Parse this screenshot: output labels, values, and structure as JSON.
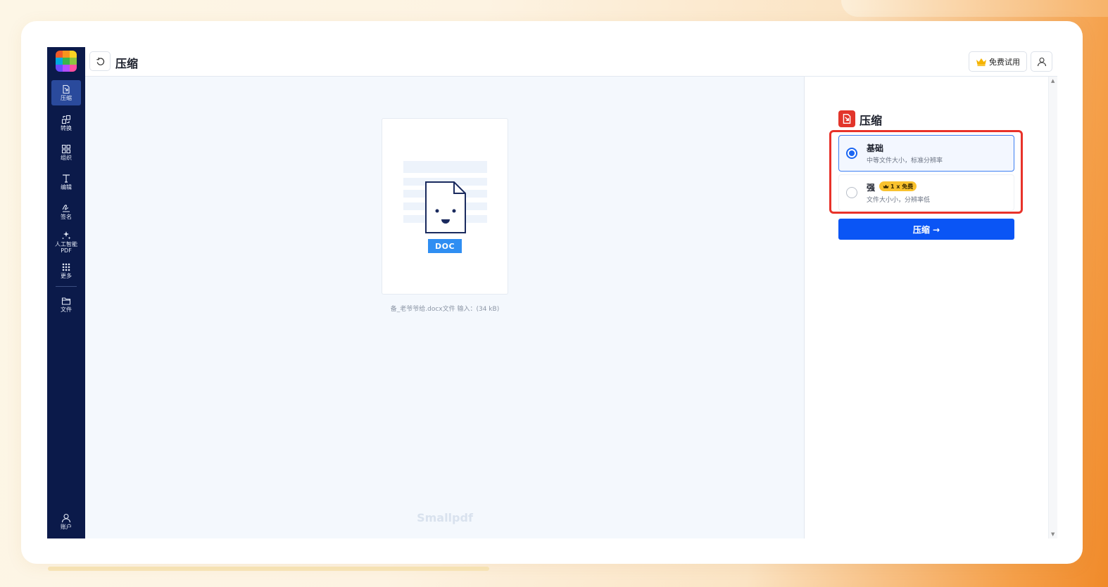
{
  "header": {
    "title": "压缩",
    "back_icon": "undo-icon",
    "trial_label": "免费试用",
    "trial_icon": "crown-icon",
    "user_icon": "user-icon"
  },
  "sidebar": {
    "logo_colors": [
      "#f05a28",
      "#f7941d",
      "#f9d423",
      "#00a9e0",
      "#39b54a",
      "#8dc63f",
      "#6a4cff",
      "#b44dff",
      "#ff4fa0"
    ],
    "items": [
      {
        "label": "压缩",
        "icon": "compress-icon",
        "active": true
      },
      {
        "label": "转换",
        "icon": "convert-icon",
        "active": false
      },
      {
        "label": "组织",
        "icon": "grid-icon",
        "active": false
      },
      {
        "label": "编辑",
        "icon": "text-icon",
        "active": false
      },
      {
        "label": "签名",
        "icon": "signature-icon",
        "active": false
      },
      {
        "label": "人工智能\nPDF",
        "label_line1": "人工智能",
        "label_line2": "PDF",
        "icon": "sparkle-icon",
        "active": false
      },
      {
        "label": "更多",
        "icon": "more-grid-icon",
        "active": false
      },
      {
        "label": "文件",
        "icon": "folder-icon",
        "active": false
      }
    ],
    "account_label": "账户",
    "account_icon": "account-icon"
  },
  "preview": {
    "doc_badge": "DOC",
    "file_caption": "备_老爷爷给.docx文件 输入：(34 kB)",
    "watermark": "Smallpdf"
  },
  "panel": {
    "title": "压缩",
    "title_icon": "compress-red-icon",
    "options": [
      {
        "title": "基础",
        "desc": "中等文件大小，标准分辨率",
        "selected": true
      },
      {
        "title": "强",
        "desc": "文件大小小，分辨率低",
        "selected": false,
        "badge": "1 x 免费"
      }
    ],
    "button_label": "压缩 →",
    "accent_color": "#0a55f5",
    "highlight_color": "#e8322a"
  }
}
